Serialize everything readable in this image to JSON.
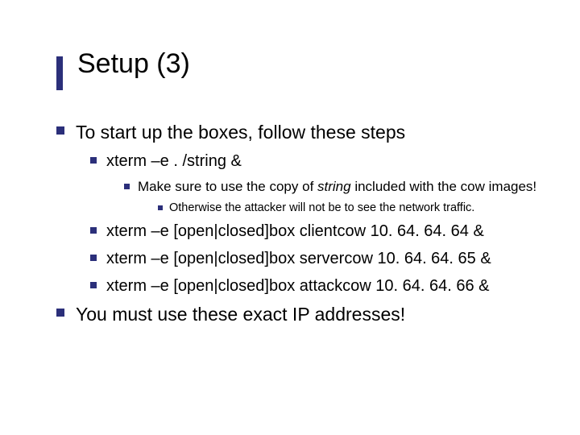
{
  "title": "Setup (3)",
  "l1a": "To start up the boxes, follow these steps",
  "l2a": "xterm –e . /string &",
  "l3a_pre": "Make sure to use the copy of ",
  "l3a_em": "string",
  "l3a_post": " included with the cow images!",
  "l4a": "Otherwise the attacker will not be to see the network traffic.",
  "l2b": "xterm –e [open|closed]box clientcow 10. 64. 64. 64 &",
  "l2c": "xterm –e [open|closed]box servercow 10. 64. 64. 65 &",
  "l2d": "xterm –e [open|closed]box attackcow 10. 64. 64. 66 &",
  "l1b": "You must use these exact IP addresses!"
}
